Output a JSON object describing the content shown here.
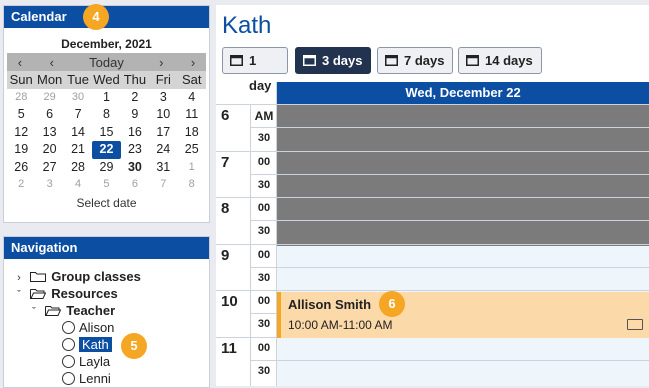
{
  "calendar": {
    "title": "Calendar",
    "badge": "4",
    "month_title": "December, 2021",
    "nav": {
      "prev2": "‹",
      "prev": "‹",
      "today": "Today",
      "next": "›",
      "next2": "›"
    },
    "weekdays": [
      "Sun",
      "Mon",
      "Tue",
      "Wed",
      "Thu",
      "Fri",
      "Sat"
    ],
    "weeks": [
      [
        "28",
        "29",
        "30",
        "1",
        "2",
        "3",
        "4"
      ],
      [
        "5",
        "6",
        "7",
        "8",
        "9",
        "10",
        "11"
      ],
      [
        "12",
        "13",
        "14",
        "15",
        "16",
        "17",
        "18"
      ],
      [
        "19",
        "20",
        "21",
        "22",
        "23",
        "24",
        "25"
      ],
      [
        "26",
        "27",
        "28",
        "29",
        "30",
        "31",
        "1"
      ],
      [
        "2",
        "3",
        "4",
        "5",
        "6",
        "7",
        "8"
      ]
    ],
    "select_date": "Select date"
  },
  "navigation": {
    "title": "Navigation",
    "badge": "5",
    "items": {
      "group_classes": "Group classes",
      "resources": "Resources",
      "teacher": "Teacher",
      "alison": "Alison",
      "kath": "Kath",
      "layla": "Layla",
      "lenni": "Lenni"
    }
  },
  "main": {
    "title": "Kath",
    "view_buttons": [
      "1 day",
      "3 days",
      "7 days",
      "14 days"
    ],
    "active_view": "3 days",
    "day_header": "Wed, December 22",
    "hours": [
      "6",
      "7",
      "8",
      "9",
      "10",
      "11"
    ],
    "am_label": "AM",
    "minutes": [
      "00",
      "30"
    ],
    "event": {
      "name": "Allison Smith",
      "time": "10:00 AM-11:00 AM",
      "badge": "6"
    }
  },
  "colors": {
    "accent": "#0b4ea2",
    "badge": "#f5a623",
    "event_bg": "#fcd9a8",
    "unavailable": "#7b7b7b"
  }
}
